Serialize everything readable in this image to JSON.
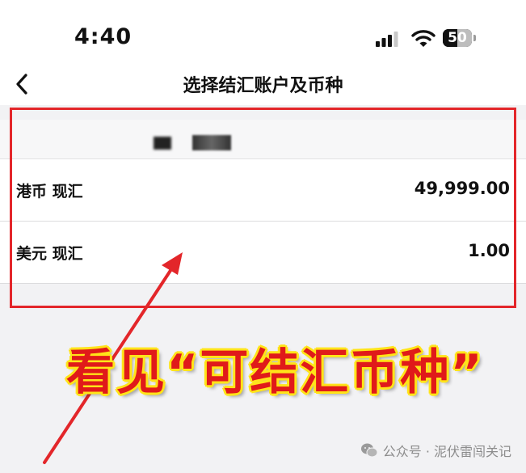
{
  "status_bar": {
    "time": "4:40",
    "battery": "50",
    "battery_level_percent": 50
  },
  "nav": {
    "title": "选择结汇账户及币种",
    "back_icon": "chevron-left-icon"
  },
  "currencies": [
    {
      "name": "港币 现汇",
      "amount": "49,999.00"
    },
    {
      "name": "美元 现汇",
      "amount": "1.00"
    }
  ],
  "annotation": {
    "text": "看见“可结汇币种”"
  },
  "watermark": {
    "text": "公众号 · 泥伏雷闯关记"
  },
  "colors": {
    "highlight": "#e3262a",
    "annotation_text": "#e01a1a",
    "annotation_outline": "#ffe419"
  }
}
